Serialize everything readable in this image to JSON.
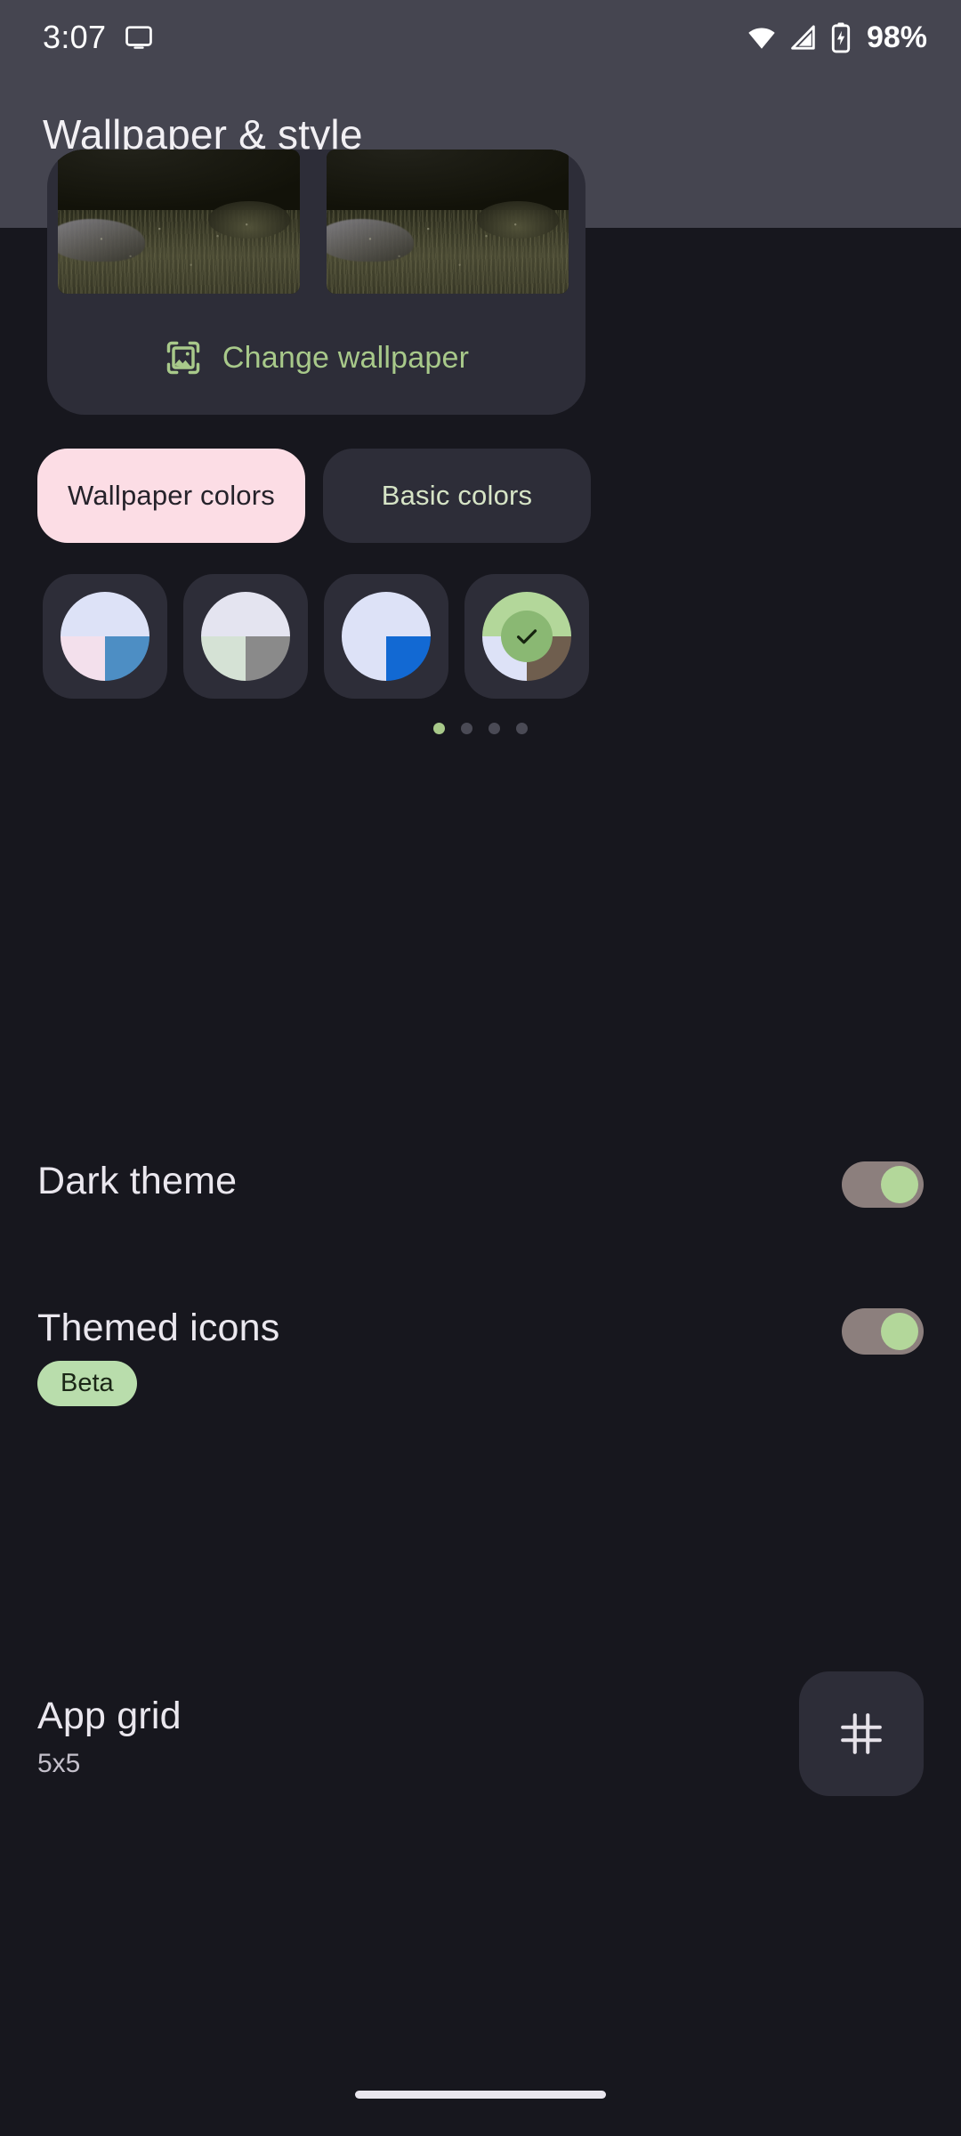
{
  "status_bar": {
    "time": "3:07",
    "battery_percent": "98%",
    "icons": [
      "cast-icon",
      "wifi-icon",
      "cellular-signal-icon",
      "battery-charging-icon"
    ]
  },
  "header": {
    "title": "Wallpaper & style"
  },
  "wallpaper_preview": {
    "change_wallpaper_label": "Change wallpaper",
    "change_wallpaper_icon": "image-frame-icon",
    "accent_green": "#a8c98a",
    "thumbnails": [
      {
        "name": "home-screen-preview",
        "description": "dark grassy field landscape"
      },
      {
        "name": "lock-screen-preview",
        "description": "dark grassy field landscape"
      }
    ]
  },
  "color_source_tabs": [
    {
      "label": "Wallpaper colors",
      "selected": true,
      "bg": "#fcdde5",
      "fg": "#25222a"
    },
    {
      "label": "Basic colors",
      "selected": false,
      "bg": "#2d2d38",
      "fg": "#d6e4c6"
    }
  ],
  "color_swatches": [
    {
      "name": "color-option-1",
      "selected": false,
      "top": "#dde2f7",
      "bottom_left": "#f3e0ec",
      "bottom_right": "#4d8ec4"
    },
    {
      "name": "color-option-2",
      "selected": false,
      "top": "#e4e4f0",
      "bottom_left": "#d5e2d5",
      "bottom_right": "#8a8a8a"
    },
    {
      "name": "color-option-3",
      "selected": false,
      "top": "#dde2f7",
      "bottom_left": "#dde2f7",
      "bottom_right": "#1269d3"
    },
    {
      "name": "color-option-4",
      "selected": true,
      "top": "#b3d79a",
      "bottom_left": "#dde2f7",
      "bottom_right": "#6f5e4e",
      "check_bg": "#8ab873",
      "check_fg": "#16240f",
      "check_icon": "check-icon"
    }
  ],
  "page_dots": {
    "count": 4,
    "active_index": 0,
    "active_color": "#a8c98a",
    "inactive_color": "#4a4a55"
  },
  "settings": {
    "dark_theme": {
      "title": "Dark theme",
      "enabled": true
    },
    "themed_icons": {
      "title": "Themed icons",
      "enabled": true,
      "badge": "Beta"
    },
    "app_grid": {
      "title": "App grid",
      "value": "5x5",
      "icon": "grid-icon"
    }
  }
}
